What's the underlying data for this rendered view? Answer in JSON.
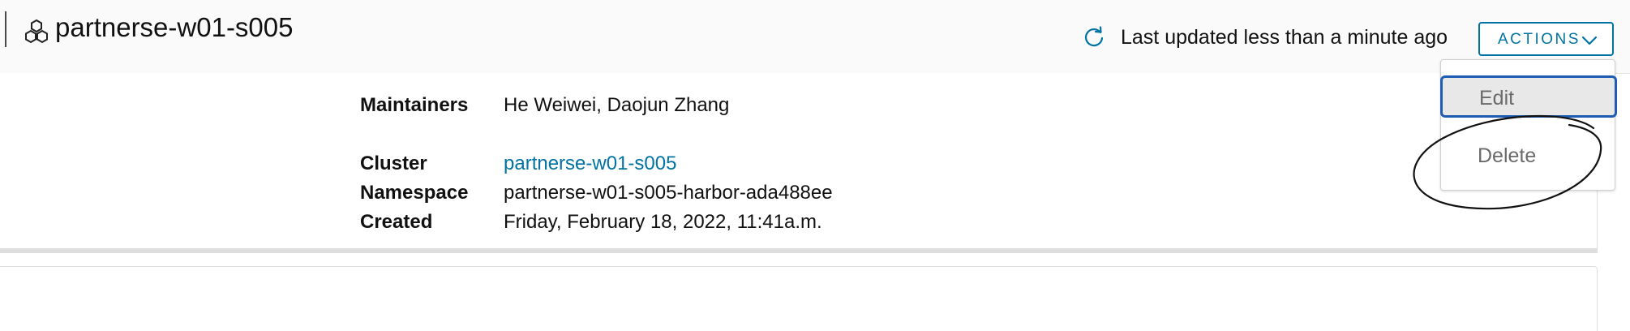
{
  "header": {
    "title": "partnerse-w01-s005",
    "title_icon": "cluster-hexagons-icon",
    "refresh_icon": "refresh-icon",
    "last_updated": "Last updated less than a minute ago",
    "actions_label": "ACTIONS",
    "actions_icon": "chevron-down-icon"
  },
  "details": {
    "maintainers_label": "Maintainers",
    "maintainers_value": "He Weiwei, Daojun Zhang",
    "cluster_label": "Cluster",
    "cluster_value": "partnerse-w01-s005",
    "namespace_label": "Namespace",
    "namespace_value": "partnerse-w01-s005-harbor-ada488ee",
    "created_label": "Created",
    "created_value": "Friday, February 18, 2022, 11:41a.m."
  },
  "actions_menu": {
    "items": [
      {
        "label": "Edit",
        "state": "focused"
      },
      {
        "label": "Delete",
        "state": "normal"
      }
    ]
  },
  "colors": {
    "accent": "#0072a3",
    "focus_border": "#1f5cb3",
    "header_bg": "#fafafa",
    "menu_text": "#6a6a6a"
  }
}
